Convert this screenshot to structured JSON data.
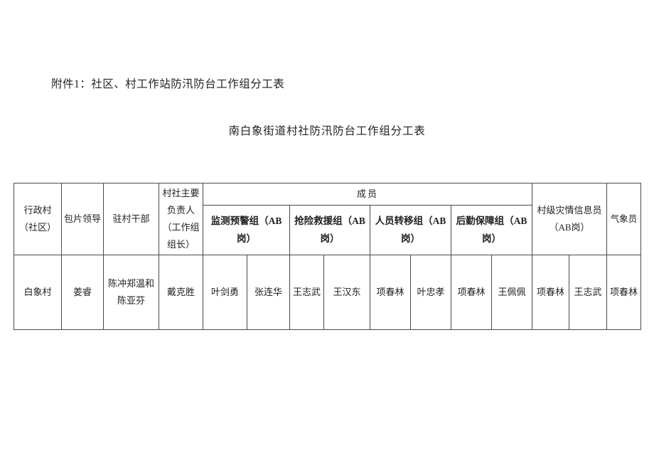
{
  "document": {
    "attachment_label": "附件1：社区、村工作站防汛防台工作组分工表",
    "title": "南白象街道村社防汛防台工作组分工表"
  },
  "table": {
    "headers": {
      "village": "行政村（社区）",
      "area_leader": "包片领导",
      "stationed_cadre": "驻村干部",
      "chief_officer": "村社主要负责人（工作组组长）",
      "members_group": "成员",
      "member_subgroups": [
        "监测预警组（AB岗）",
        "抢险救援组（AB岗）",
        "人员转移组（AB岗）",
        "后勤保障组（AB岗）"
      ],
      "disaster_info_officer": "村级灾情信息员（AB岗）",
      "weather_officer": "气象员"
    },
    "rows": [
      {
        "village": "白象村",
        "area_leader": "姜睿",
        "stationed_cadre": "陈冲郑温和陈亚芬",
        "chief_officer": "戴克胜",
        "monitoring_a": "叶剑勇",
        "monitoring_b": "张连华",
        "rescue_a": "王志武",
        "rescue_b": "王汉东",
        "transfer_a": "项春林",
        "transfer_b": "叶忠孝",
        "logistics_a": "项春林",
        "logistics_b": "王佩佩",
        "info_a": "项春林",
        "info_b": "王志武",
        "weather": "项春林"
      }
    ]
  }
}
